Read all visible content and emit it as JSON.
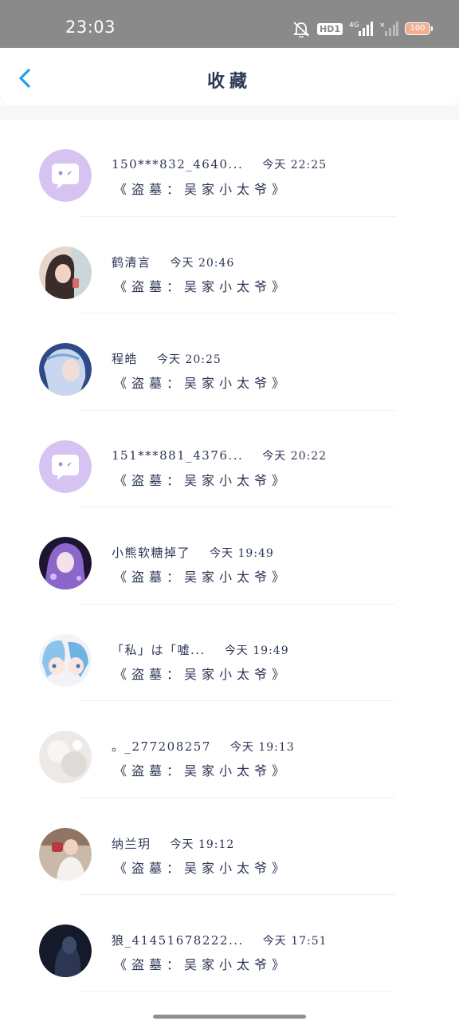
{
  "status_bar": {
    "time": "23:03",
    "hd": "HD1",
    "network": "4G",
    "battery": "100"
  },
  "header": {
    "title": "收藏"
  },
  "colors": {
    "accent": "#1f9fe8",
    "text": "#2b3654",
    "default_avatar": "#d7c3f2"
  },
  "items": [
    {
      "name": "150***832_4640...",
      "time": "今天 22:25",
      "subtitle": "《盗墓：吴家小太爷》",
      "avatar": "default-app-avatar"
    },
    {
      "name": "鹤清言",
      "time": "今天 20:46",
      "subtitle": "《盗墓：吴家小太爷》",
      "avatar": "photo-girl-avatar"
    },
    {
      "name": "程皓",
      "time": "今天 20:25",
      "subtitle": "《盗墓：吴家小太爷》",
      "avatar": "anime-blue-avatar"
    },
    {
      "name": "151***881_4376...",
      "time": "今天 20:22",
      "subtitle": "《盗墓：吴家小太爷》",
      "avatar": "default-app-avatar"
    },
    {
      "name": "小熊软糖掉了",
      "time": "今天 19:49",
      "subtitle": "《盗墓：吴家小太爷》",
      "avatar": "anime-purple-avatar"
    },
    {
      "name": "「私」は「嘘...",
      "time": "今天 19:49",
      "subtitle": "《盗墓：吴家小太爷》",
      "avatar": "chibi-avatar"
    },
    {
      "name": "。_277208257",
      "time": "今天 19:13",
      "subtitle": "《盗墓：吴家小太爷》",
      "avatar": "light-texture-avatar"
    },
    {
      "name": "纳兰玥",
      "time": "今天 19:12",
      "subtitle": "《盗墓：吴家小太爷》",
      "avatar": "photo-camera-avatar"
    },
    {
      "name": "狼_41451678222...",
      "time": "今天 17:51",
      "subtitle": "《盗墓：吴家小太爷》",
      "avatar": "dark-photo-avatar"
    }
  ]
}
